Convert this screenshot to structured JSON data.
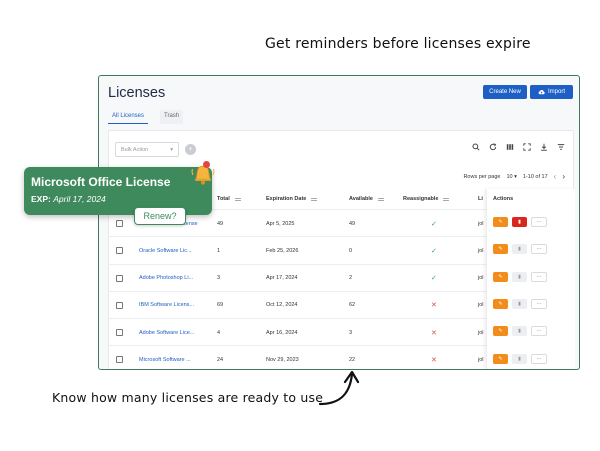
{
  "captions": {
    "top": "Get reminders before licenses expire",
    "bottom": "Know how many licenses are ready to use"
  },
  "app": {
    "title": "Licenses",
    "create_label": "Create New",
    "import_label": "Import",
    "tabs": [
      "All Licenses",
      "Trash"
    ],
    "bulk_action_placeholder": "Bulk Action",
    "toolbar_icons": [
      "search-icon",
      "refresh-icon",
      "columns-icon",
      "fullscreen-icon",
      "download-icon",
      "filter-icon"
    ],
    "pager": {
      "rows_per_page_label": "Rows per page",
      "rows_per_page_value": "10",
      "range": "1-10 of 17"
    },
    "columns": {
      "total": "Total",
      "expiration": "Expiration Date",
      "available": "Available",
      "reassignable": "Reassignable",
      "licensed_to_partial": "Li",
      "actions": "Actions"
    },
    "rows": [
      {
        "name": "Microsoft Office License",
        "total": "49",
        "expiration": "Apr 5, 2025",
        "available": "49",
        "reassignable": true,
        "licensed_to": "jol",
        "deletable": true
      },
      {
        "name": "Oracle Software Lic...",
        "total": "1",
        "expiration": "Feb 25, 2026",
        "available": "0",
        "reassignable": true,
        "licensed_to": "jol",
        "deletable": false
      },
      {
        "name": "Adobe Photoshop Li...",
        "total": "3",
        "expiration": "Apr 17, 2024",
        "available": "2",
        "reassignable": true,
        "licensed_to": "jol",
        "deletable": false
      },
      {
        "name": "IBM Software Licens...",
        "total": "69",
        "expiration": "Oct 12, 2024",
        "available": "62",
        "reassignable": false,
        "licensed_to": "jol",
        "deletable": false
      },
      {
        "name": "Adobe Software Lice...",
        "total": "4",
        "expiration": "Apr 16, 2024",
        "available": "3",
        "reassignable": false,
        "licensed_to": "jol",
        "deletable": false
      },
      {
        "name": "Microsoft Software ...",
        "total": "24",
        "expiration": "Nov 29, 2023",
        "available": "22",
        "reassignable": false,
        "licensed_to": "jol",
        "deletable": false
      }
    ]
  },
  "popup": {
    "title": "Microsoft Office License",
    "exp_label": "EXP:",
    "exp_date": "April 17, 2024",
    "renew_label": "Renew?"
  },
  "colors": {
    "brand_green": "#3f8a5c",
    "primary_blue": "#1d5fc4",
    "edit_orange": "#f28c1a",
    "delete_red": "#d9271c",
    "check_green": "#2ea26b",
    "cross_red": "#e04848"
  }
}
